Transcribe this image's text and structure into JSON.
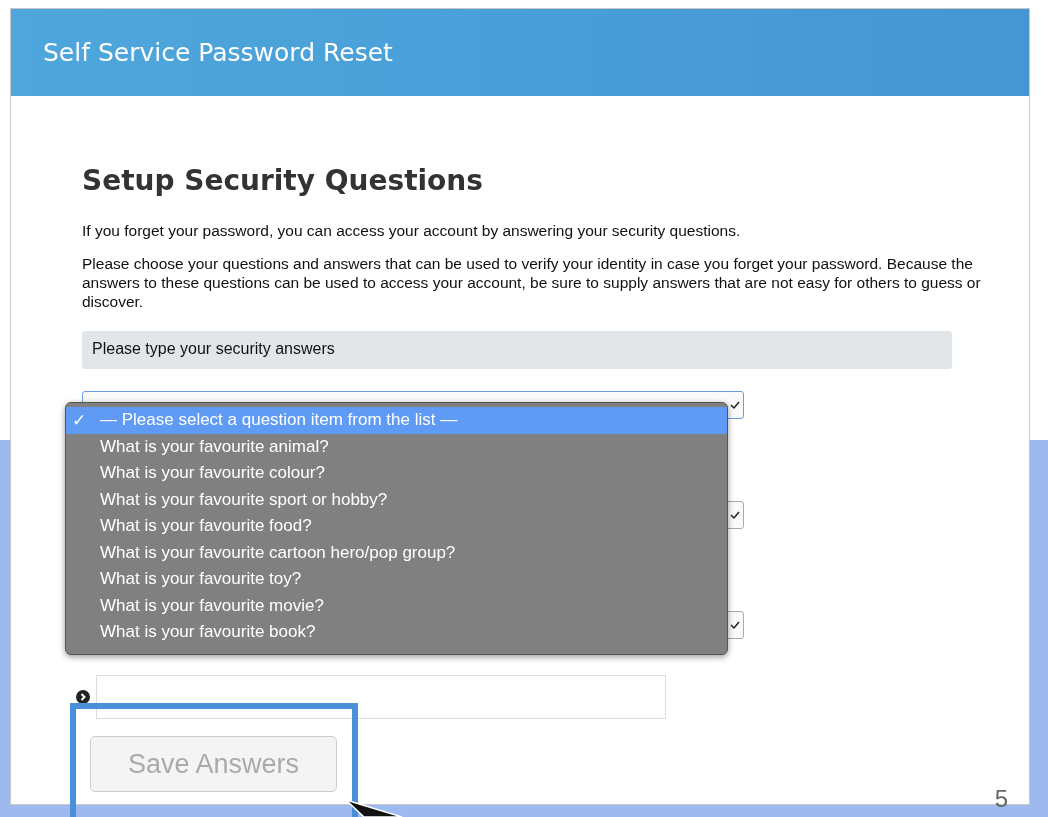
{
  "header": {
    "title": "Self Service Password Reset"
  },
  "heading": "Setup Security Questions",
  "paragraphs": [
    "If you forget your password, you can access your account by answering your security questions.",
    "Please choose your questions and answers that can be used to verify your identity in case you forget your password. Because the answers to these questions can be used to access your account, be sure to supply answers that are not easy for others to guess or discover."
  ],
  "banner": "Please type your security answers",
  "question_selects": [
    {
      "open": true
    },
    {
      "open": false
    },
    {
      "open": false
    }
  ],
  "dropdown": {
    "check": "✓",
    "options": [
      {
        "label": "— Please select a question item from the list —",
        "selected": true
      },
      {
        "label": "What is your favourite animal?",
        "selected": false
      },
      {
        "label": "What is your favourite colour?",
        "selected": false
      },
      {
        "label": "What is your favourite sport or hobby?",
        "selected": false
      },
      {
        "label": "What is your favourite food?",
        "selected": false
      },
      {
        "label": "What is your favourite cartoon hero/pop group?",
        "selected": false
      },
      {
        "label": "What is your favourite toy?",
        "selected": false
      },
      {
        "label": "What is your favourite movie?",
        "selected": false
      },
      {
        "label": "What is your favourite book?",
        "selected": false
      }
    ]
  },
  "save_button": {
    "label": "Save Answers",
    "disabled": true
  },
  "page_number": "5"
}
